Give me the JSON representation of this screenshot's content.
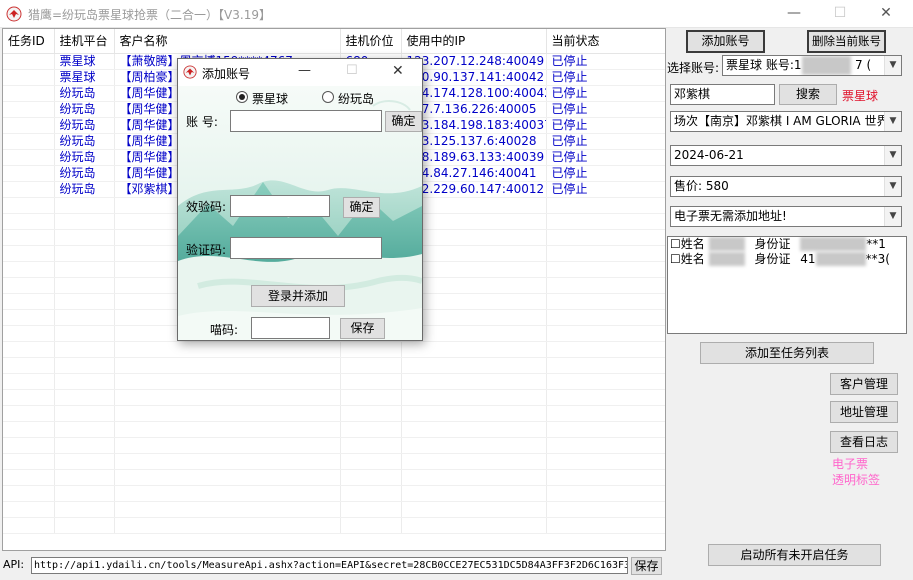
{
  "window": {
    "title": "猎鹰=纷玩岛票星球抢票（二合一）【V3.19】",
    "minimize": "—",
    "maximize": "☐",
    "close": "✕"
  },
  "table": {
    "columns": [
      "任务ID",
      "挂机平台",
      "客户名称",
      "挂机价位",
      "使用中的IP",
      "当前状态"
    ],
    "rows": [
      [
        "",
        "票星球",
        "【萧敬腾】周京博159****4767",
        "680",
        "123.207.12.248:40049",
        "已停止"
      ],
      [
        "",
        "票星球",
        "【周柏豪】",
        "",
        "180.90.137.141:40042",
        "已停止"
      ],
      [
        "",
        "纷玩岛",
        "【周华健】",
        "",
        "114.174.128.100:40042",
        "已停止"
      ],
      [
        "",
        "纷玩岛",
        "【周华健】",
        "",
        "117.7.136.226:40005",
        "已停止"
      ],
      [
        "",
        "纷玩岛",
        "【周华健】",
        "",
        "183.184.198.183:40037",
        "已停止"
      ],
      [
        "",
        "纷玩岛",
        "【周华健】",
        "",
        "183.125.137.6:40028",
        "已停止"
      ],
      [
        "",
        "纷玩岛",
        "【周华健】",
        "",
        "118.189.63.133:40039",
        "已停止"
      ],
      [
        "",
        "纷玩岛",
        "【周华健】",
        "",
        "114.84.27.146:40041",
        "已停止"
      ],
      [
        "",
        "纷玩岛",
        "【邓紫棋】",
        "",
        "122.229.60.147:40012",
        "已停止"
      ]
    ]
  },
  "api": {
    "label": "API:",
    "value": "http://api1.ydaili.cn/tools/MeasureApi.ashx?action=EAPI&secret=28CB0CCE27EC531DC5D84A3FF3F2D6C163F3",
    "save_label": "保存"
  },
  "right": {
    "add_account": "添加账号",
    "delete_account": "删除当前账号",
    "select_account_label": "选择账号:",
    "select_account_value": "票星球 账号:1",
    "select_account_tail": "7 (",
    "search_value": "邓紫棋",
    "search_button": "搜索",
    "platform_tag": "票星球",
    "session_value": "场次【南京】邓紫棋 I AM GLORIA 世界",
    "date_value": "2024-06-21",
    "price_value": "售价: 580",
    "address_value": "电子票无需添加地址!",
    "buyers": [
      {
        "name_label": "姓名",
        "id_label": "身份证",
        "id_tail": "**1"
      },
      {
        "name_label": "姓名",
        "id_label": "身份证",
        "id_prefix": "41",
        "id_tail": "**3("
      }
    ],
    "add_to_tasks": "添加至任务列表",
    "customer_mgmt": "客户管理",
    "address_mgmt": "地址管理",
    "view_log": "查看日志",
    "eticket_note": "电子票",
    "transparent_tag": "透明标签",
    "start_all": "启动所有未开启任务"
  },
  "dialog": {
    "title": "添加账号",
    "minimize": "—",
    "maximize": "☐",
    "close": "✕",
    "radio_1": "票星球",
    "radio_2": "纷玩岛",
    "account_label": "账  号:",
    "confirm_1": "确定",
    "captcha_label": "效验码:",
    "confirm_2": "确定",
    "verify_label": "验证码:",
    "login_add": "登录并添加",
    "code_label": "喵码:",
    "save": "保存"
  },
  "colors": {
    "link_blue": "#0000c8",
    "tag_red": "#e0102a",
    "pink": "#ff66cc"
  }
}
